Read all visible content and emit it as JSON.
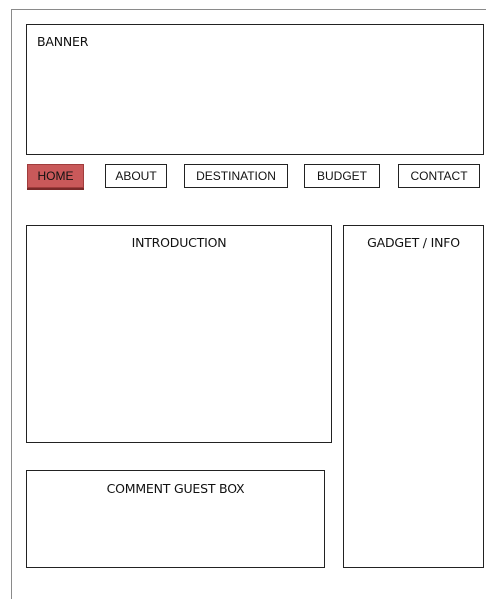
{
  "banner": {
    "label": "BANNER"
  },
  "nav": {
    "items": [
      {
        "label": "HOME",
        "active": true
      },
      {
        "label": "ABOUT",
        "active": false
      },
      {
        "label": "DESTINATION",
        "active": false
      },
      {
        "label": "BUDGET",
        "active": false
      },
      {
        "label": "CONTACT",
        "active": false
      }
    ],
    "active_color": "#c9595a"
  },
  "sections": {
    "introduction": {
      "label": "INTRODUCTION"
    },
    "gadget_info": {
      "label": "GADGET / INFO"
    },
    "comment_guest_box": {
      "label": "COMMENT GUEST BOX"
    }
  }
}
